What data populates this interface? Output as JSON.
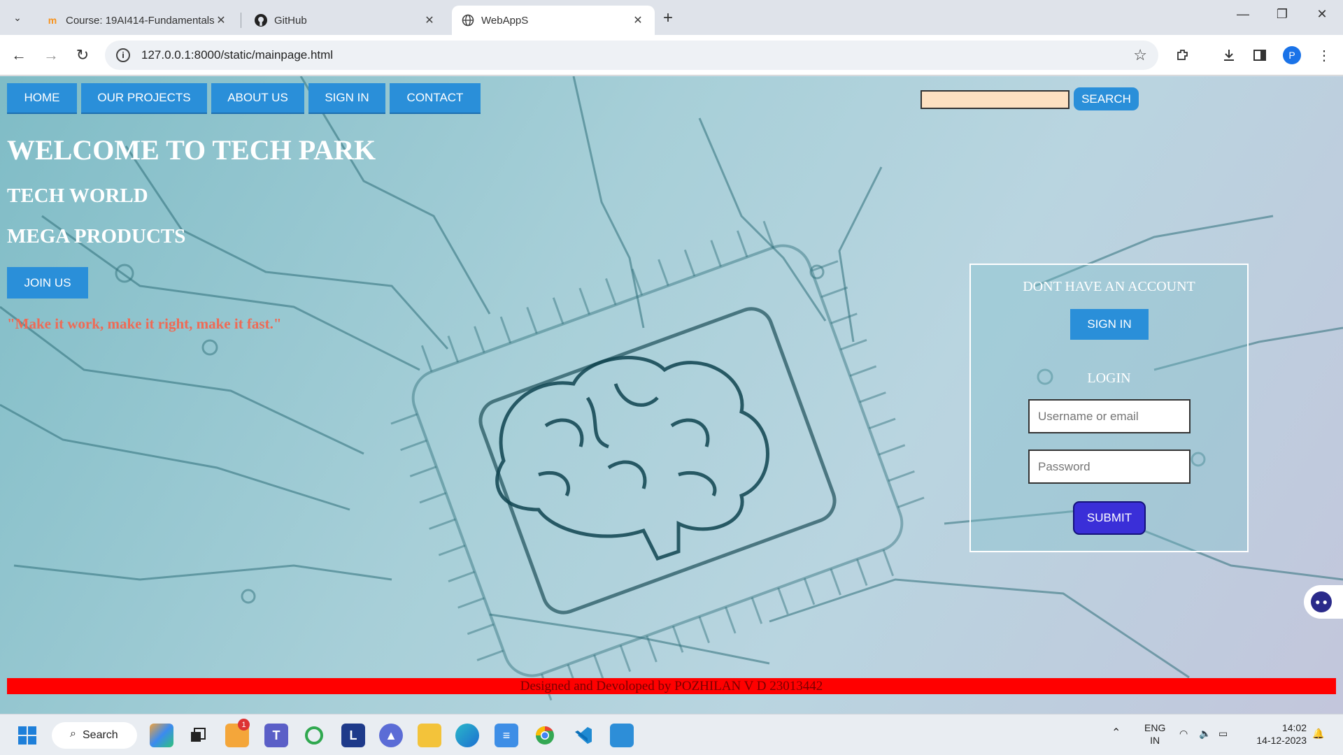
{
  "browser": {
    "tabs": [
      {
        "title": "Course: 19AI414-Fundamentals",
        "favicon": "moodle-icon",
        "active": false
      },
      {
        "title": "GitHub",
        "favicon": "github-icon",
        "active": false
      },
      {
        "title": "WebAppS",
        "favicon": "globe-icon",
        "active": true
      }
    ],
    "url": "127.0.0.1:8000/static/mainpage.html",
    "profile_initial": "P"
  },
  "page": {
    "nav": [
      "HOME",
      "OUR PROJECTS",
      "ABOUT US",
      "SIGN IN",
      "CONTACT"
    ],
    "search_button": "SEARCH",
    "search_value": "",
    "headline": "WELCOME TO TECH PARK",
    "subhead1": "TECH WORLD",
    "subhead2": "MEGA PRODUCTS",
    "join_button": "JOIN US",
    "quote": "\"Make it work, make it right, make it fast.\"",
    "panel": {
      "no_account_caption": "DONT HAVE AN ACCOUNT",
      "signin_button": "SIGN IN",
      "login_caption": "LOGIN",
      "username_placeholder": "Username or email",
      "password_placeholder": "Password",
      "submit_button": "SUBMIT"
    },
    "footer": "Designed and Devoloped by POZHILAN V D 23013442",
    "colors": {
      "nav_blue": "#2a8fd9",
      "footer_red": "#ff0000",
      "quote_red": "#ef6a55",
      "submit_purple": "#3a2fd8",
      "search_field": "#fde0c1"
    }
  },
  "taskbar": {
    "search_label": "Search",
    "notification_count": "1",
    "language": "ENG",
    "region": "IN",
    "time": "14:02",
    "date": "14-12-2023",
    "apps": [
      "copilot-icon",
      "task-view-icon",
      "mail-icon",
      "teams-icon",
      "loop-icon",
      "l-app-icon",
      "arc-icon",
      "file-explorer-icon",
      "edge-icon",
      "notepad-icon",
      "chrome-icon",
      "vscode-icon",
      "photos-icon"
    ]
  }
}
